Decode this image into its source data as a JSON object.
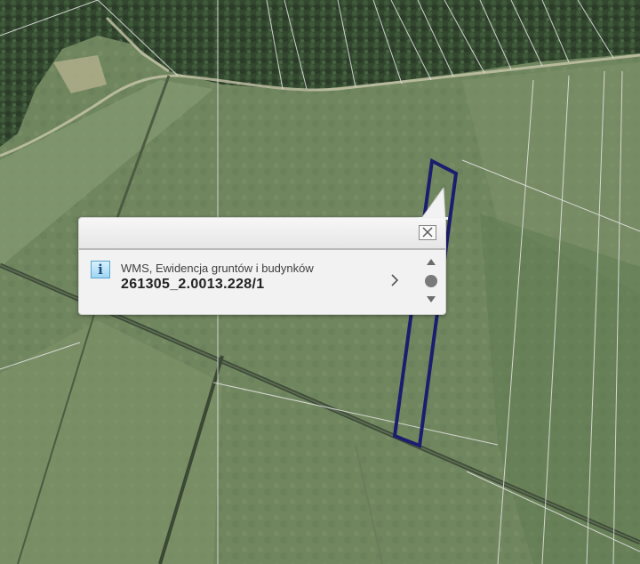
{
  "map": {
    "imagery": "aerial-orthophoto",
    "parcel_outline_color": "#1b1e6e",
    "parcel_lines_color": "#e6e6e6"
  },
  "popup": {
    "layer_name": "WMS, Ewidencja gruntów i budynków",
    "parcel_id": "261305_2.0013.228/1",
    "info_icon_glyph": "i",
    "icons": [
      "close-icon",
      "info-icon",
      "chevron-right-icon",
      "scroll-up-icon",
      "scroll-down-icon"
    ]
  }
}
